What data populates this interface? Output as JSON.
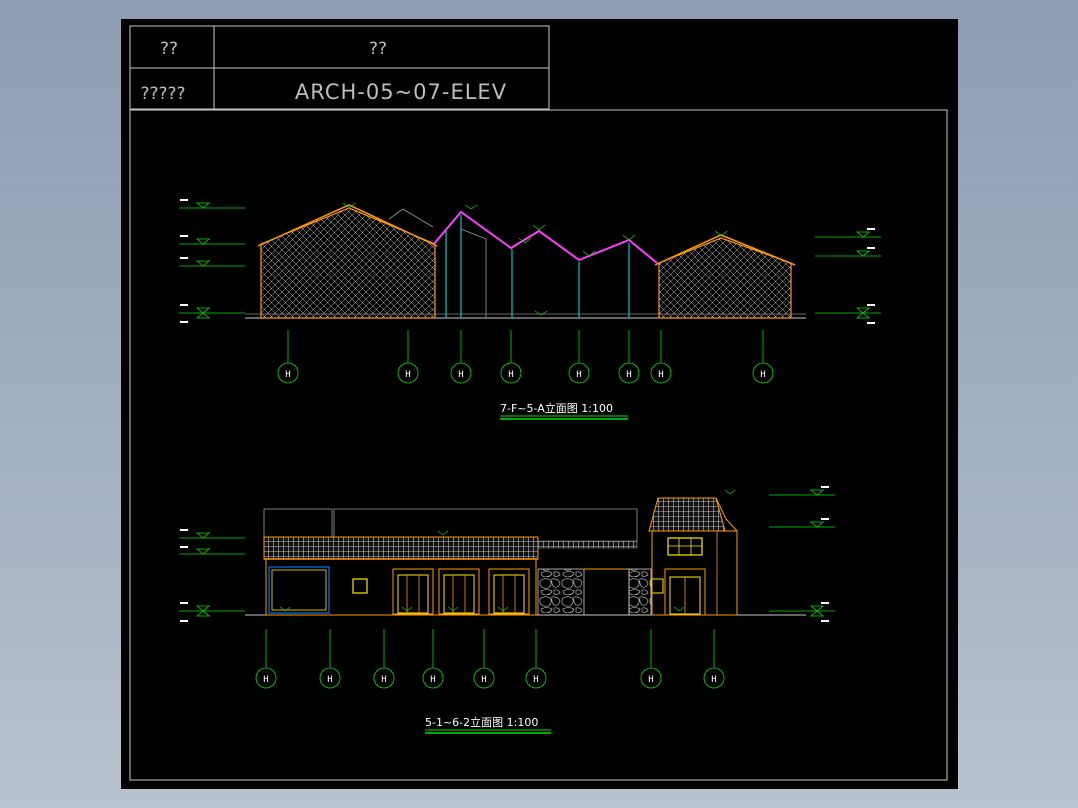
{
  "title_block": {
    "cell_r1_c1": "??",
    "cell_r1_c2": "??",
    "cell_r2_c1": "?????",
    "drawing_no": "ARCH-05~07-ELEV"
  },
  "elevation_top": {
    "title": "7-F~5-A立面图  1:100",
    "grid_labels": [
      "H",
      "H",
      "H",
      "H",
      "H",
      "H",
      "H",
      "H"
    ]
  },
  "elevation_bottom": {
    "title": "5-1~6-2立面图  1:100",
    "grid_labels": [
      "H",
      "H",
      "H",
      "H",
      "H",
      "H",
      "H",
      "H"
    ]
  },
  "colors": {
    "frame": "#c8c8c8",
    "roof_outline": "#ff9a00",
    "magenta_roof": "#ff3cff",
    "steel": "#00c8c8",
    "level_line": "#00e000",
    "wall": "#ff9a00",
    "window": "#ffe600",
    "hatch": "#d8d8d8"
  }
}
